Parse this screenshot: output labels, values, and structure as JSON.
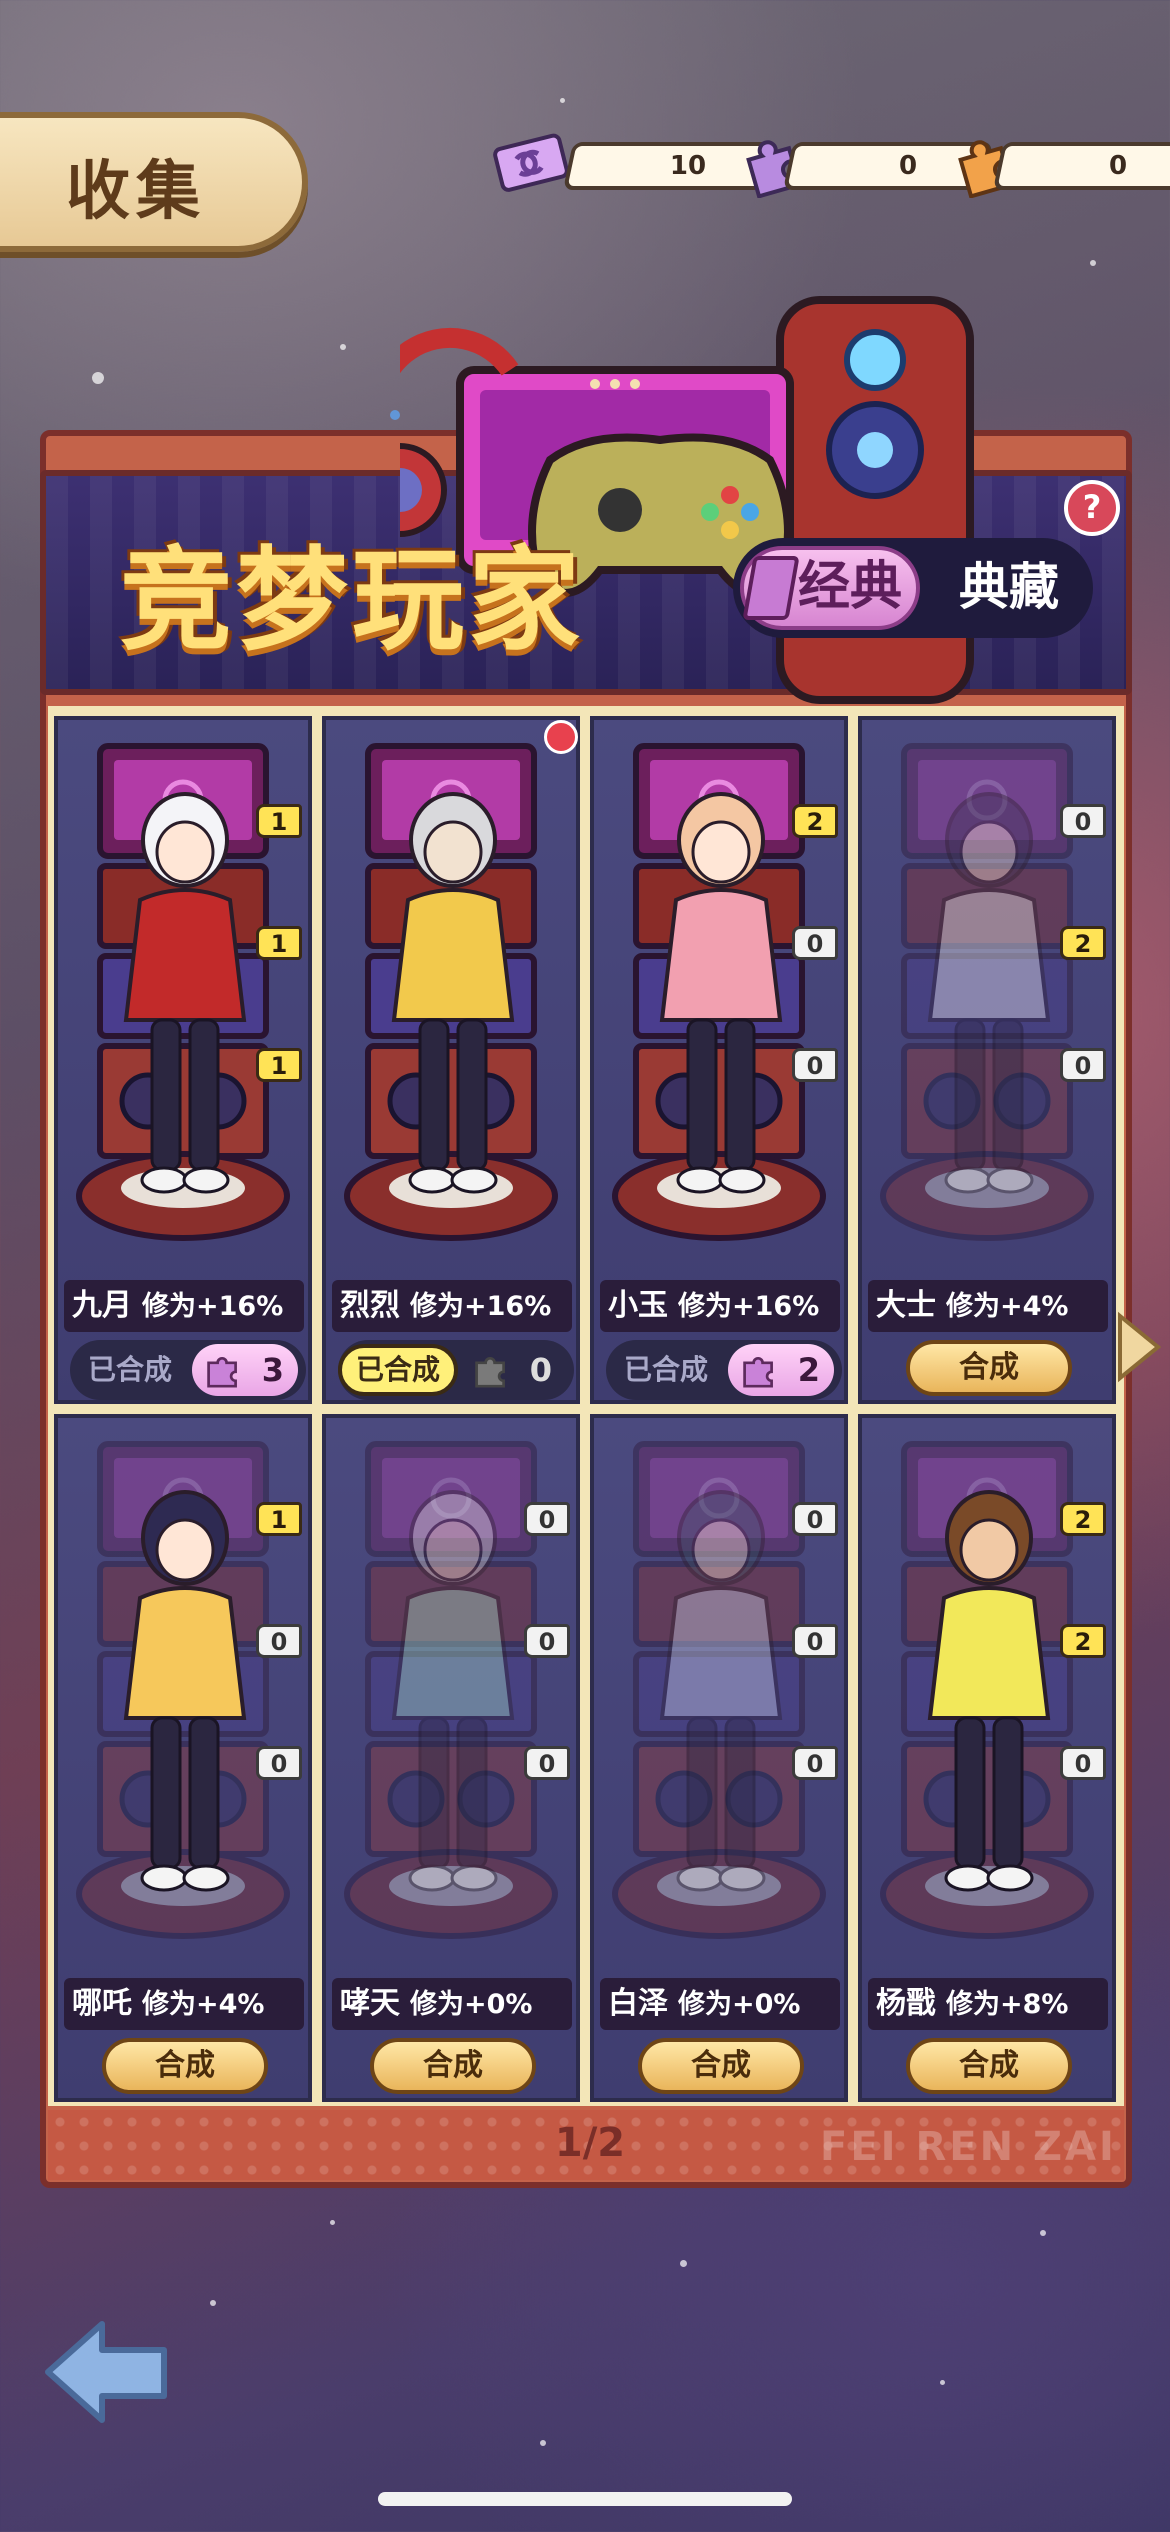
{
  "header": {
    "title": "收集",
    "resources": [
      {
        "icon": "ticket-icon",
        "value": "10"
      },
      {
        "icon": "purple-puzzle-icon",
        "value": "0"
      },
      {
        "icon": "orange-puzzle-icon",
        "value": "0"
      }
    ]
  },
  "banner": {
    "title": "竞梦玩家",
    "help": "?",
    "tabs": {
      "classic": "经典",
      "collection": "典藏",
      "active": "classic"
    }
  },
  "cards": [
    {
      "name": "九月",
      "bonus": "修为+16%",
      "owned": true,
      "owned_label": "已合成",
      "fragments": "3",
      "badges": [
        "1",
        "1",
        "1"
      ],
      "highlight": false
    },
    {
      "name": "烈烈",
      "bonus": "修为+16%",
      "owned": true,
      "owned_label": "已合成",
      "fragments": "0",
      "badges": [],
      "highlight": true
    },
    {
      "name": "小玉",
      "bonus": "修为+16%",
      "owned": true,
      "owned_label": "已合成",
      "fragments": "2",
      "badges": [
        "2",
        "0",
        "0"
      ],
      "highlight": false
    },
    {
      "name": "大士",
      "bonus": "修为+4%",
      "owned": false,
      "action": "合成",
      "badges": [
        "0",
        "2",
        "0"
      ]
    },
    {
      "name": "哪吒",
      "bonus": "修为+4%",
      "owned": false,
      "action": "合成",
      "badges": [
        "1",
        "0",
        "0"
      ]
    },
    {
      "name": "哮天",
      "bonus": "修为+0%",
      "owned": false,
      "action": "合成",
      "badges": [
        "0",
        "0",
        "0"
      ]
    },
    {
      "name": "白泽",
      "bonus": "修为+0%",
      "owned": false,
      "action": "合成",
      "badges": [
        "0",
        "0",
        "0"
      ]
    },
    {
      "name": "杨戬",
      "bonus": "修为+8%",
      "owned": false,
      "action": "合成",
      "badges": [
        "2",
        "2",
        "0"
      ]
    }
  ],
  "pagination": {
    "current": "1/2"
  },
  "footer_brand": "FEI REN ZAI",
  "colors": {
    "accent_yellow": "#ffe356",
    "panel_red": "#c4634a",
    "card_purple": "#4b4a7f"
  }
}
